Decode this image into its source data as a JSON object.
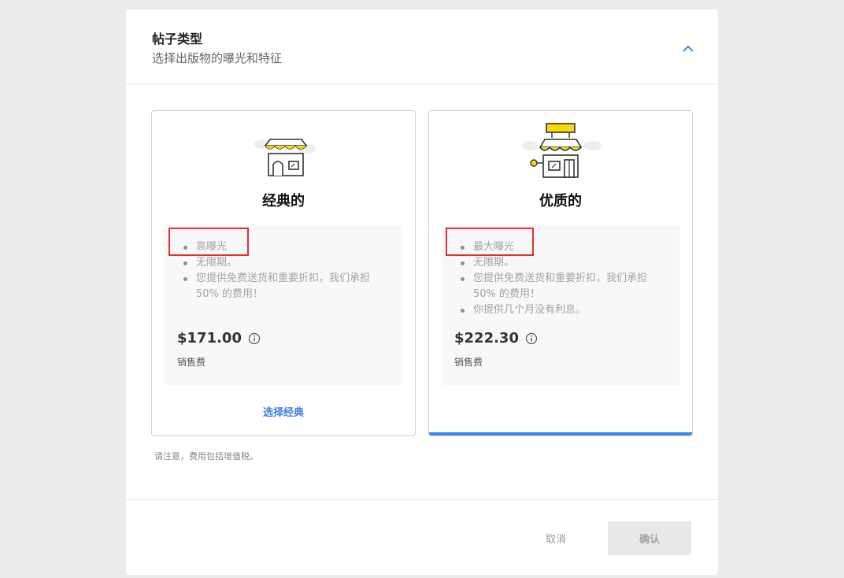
{
  "header": {
    "title": "帖子类型",
    "subtitle": "选择出版物的曝光和特征",
    "collapse_icon": "chevron-up-icon"
  },
  "cards": [
    {
      "id": "classic",
      "icon": "storefront-icon",
      "title": "经典的",
      "features": [
        "高曝光",
        "无限期。",
        "您提供免费送货和重要折扣，我们承担50% 的费用！"
      ],
      "price": "$171.00",
      "fee_label": "销售费",
      "select_label": "选择经典",
      "selected": false
    },
    {
      "id": "premium",
      "icon": "premium-storefront-icon",
      "title": "优质的",
      "features": [
        "最大曝光",
        "无限期。",
        "您提供免费送货和重要折扣，我们承担50% 的费用！",
        "你提供几个月没有利息。"
      ],
      "price": "$222.30",
      "fee_label": "销售费",
      "selected": true
    }
  ],
  "note": "请注意，费用包括增值税。",
  "footer": {
    "cancel_label": "取消",
    "confirm_label": "确认"
  },
  "colors": {
    "accent": "#3e84e8",
    "highlight_box": "#e03030",
    "awning_yellow": "#f5d90a"
  }
}
